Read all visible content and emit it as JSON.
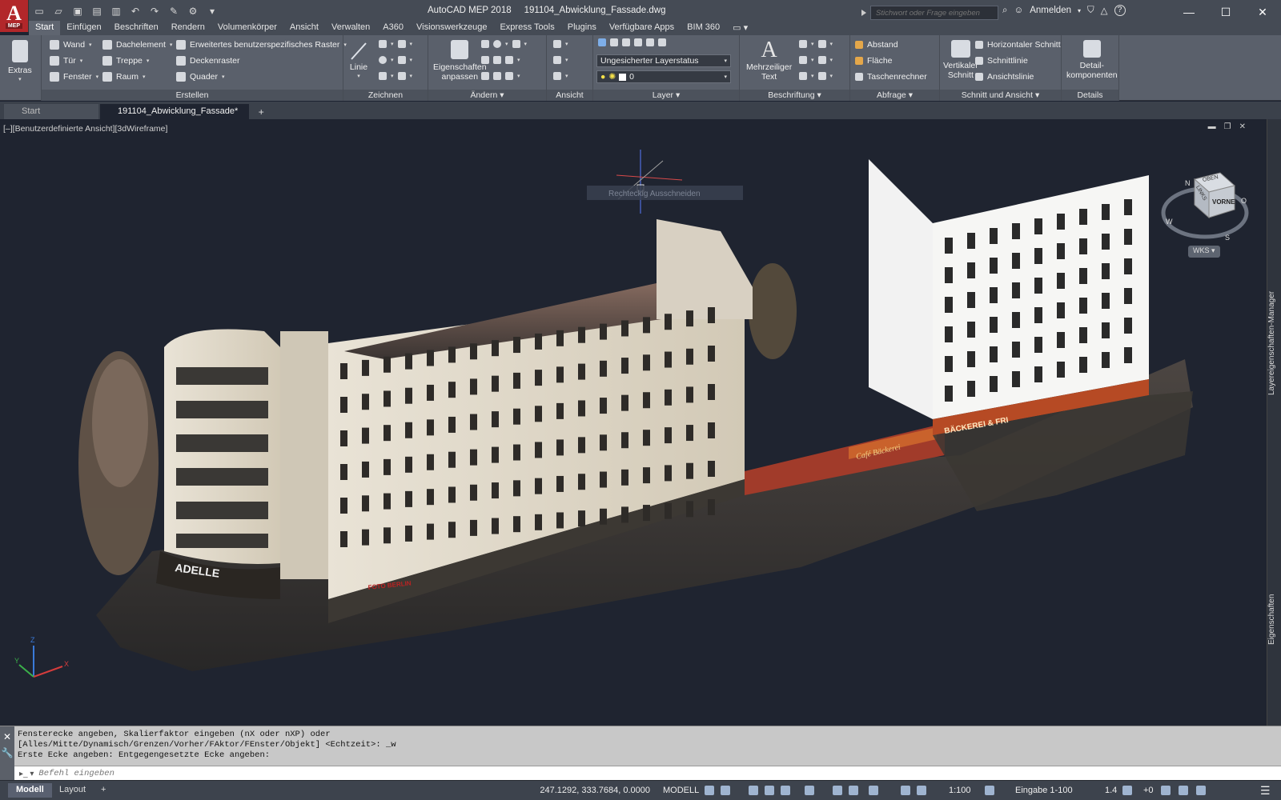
{
  "title": {
    "app_name": "AutoCAD MEP 2018",
    "document": "191104_Abwicklung_Fassade.dwg",
    "logo_letter": "A",
    "logo_sub": "MEP",
    "search_placeholder": "Stichwort oder Frage eingeben",
    "sign_in": "Anmelden",
    "help": "?"
  },
  "ribbon_tabs": [
    "Start",
    "Einfügen",
    "Beschriften",
    "Rendern",
    "Volumenkörper",
    "Ansicht",
    "Verwalten",
    "A360",
    "Visionswerkzeuge",
    "Express Tools",
    "Plugins",
    "Verfügbare Apps",
    "BIM 360"
  ],
  "ribbon": {
    "extras": "Extras",
    "build": {
      "wand": "Wand",
      "dachelement": "Dachelement",
      "raster": "Erweitertes benutzerspezifisches Raster",
      "tuer": "Tür",
      "treppe": "Treppe",
      "deckenraster": "Deckenraster",
      "fenster": "Fenster",
      "raum": "Raum",
      "quader": "Quader",
      "label": "Erstellen"
    },
    "draw": {
      "linie": "Linie",
      "label": "Zeichnen"
    },
    "modify": {
      "eigenschaften_1": "Eigenschaften",
      "eigenschaften_2": "anpassen",
      "label": "Ändern"
    },
    "view": {
      "label": "Ansicht"
    },
    "layer": {
      "status": "Ungesicherter Layerstatus",
      "current": "0",
      "label": "Layer"
    },
    "annotation": {
      "text_1": "Mehrzeiliger",
      "text_2": "Text",
      "label": "Beschriftung"
    },
    "inquiry": {
      "abstand": "Abstand",
      "flaeche": "Fläche",
      "rechner": "Taschenrechner",
      "label": "Abfrage"
    },
    "section": {
      "vert_1": "Vertikaler",
      "vert_2": "Schnitt",
      "horizontal": "Horizontaler Schnitt",
      "schnittlinie": "Schnittlinie",
      "ansichtslinie": "Ansichtslinie",
      "label": "Schnitt und Ansicht"
    },
    "details": {
      "detail_1": "Detail-",
      "detail_2": "komponenten",
      "label": "Details"
    }
  },
  "file_tabs": {
    "start": "Start",
    "active": "191104_Abwicklung_Fassade*"
  },
  "viewport": {
    "label": "[–][Benutzerdefinierte Ansicht][3dWireframe]",
    "tooltip": "Rechteckig Ausschneiden",
    "viewcube": {
      "top": "OBEN",
      "front": "VORNE",
      "left": "LINKS",
      "n": "N",
      "o": "O",
      "s": "S",
      "w": "W",
      "wcs": "WKS"
    },
    "side_tabs": [
      "Layereigenschaften-Manager",
      "Eigenschaften"
    ],
    "signs": {
      "adelle": "ADELLE",
      "foto": "FOTO BERLIN",
      "baeckerei": "BÄCKEREI & FRI",
      "cafe": "Café Bäckerei"
    }
  },
  "command": {
    "history": [
      "Fensterecke angeben, Skalierfaktor eingeben (nX oder nXP) oder",
      "[Alles/Mitte/Dynamisch/Grenzen/Vorher/FAktor/FEnster/Objekt] <Echtzeit>: _w",
      "Erste Ecke angeben: Entgegengesetzte Ecke angeben:"
    ],
    "placeholder": "Befehl eingeben"
  },
  "status": {
    "tabs": [
      "Modell",
      "Layout"
    ],
    "coords": "247.1292, 333.7684, 0.0000",
    "mode": "MODELL",
    "scale": "1:100",
    "scale2": "Eingabe 1-100",
    "cut_plane": "1.4",
    "elevation": "+0"
  },
  "colors": {
    "viewport_bg": "#1f2430",
    "ribbon_bg": "#5a606b",
    "title_bg": "#454b55",
    "logo_red": "#b2272a"
  }
}
